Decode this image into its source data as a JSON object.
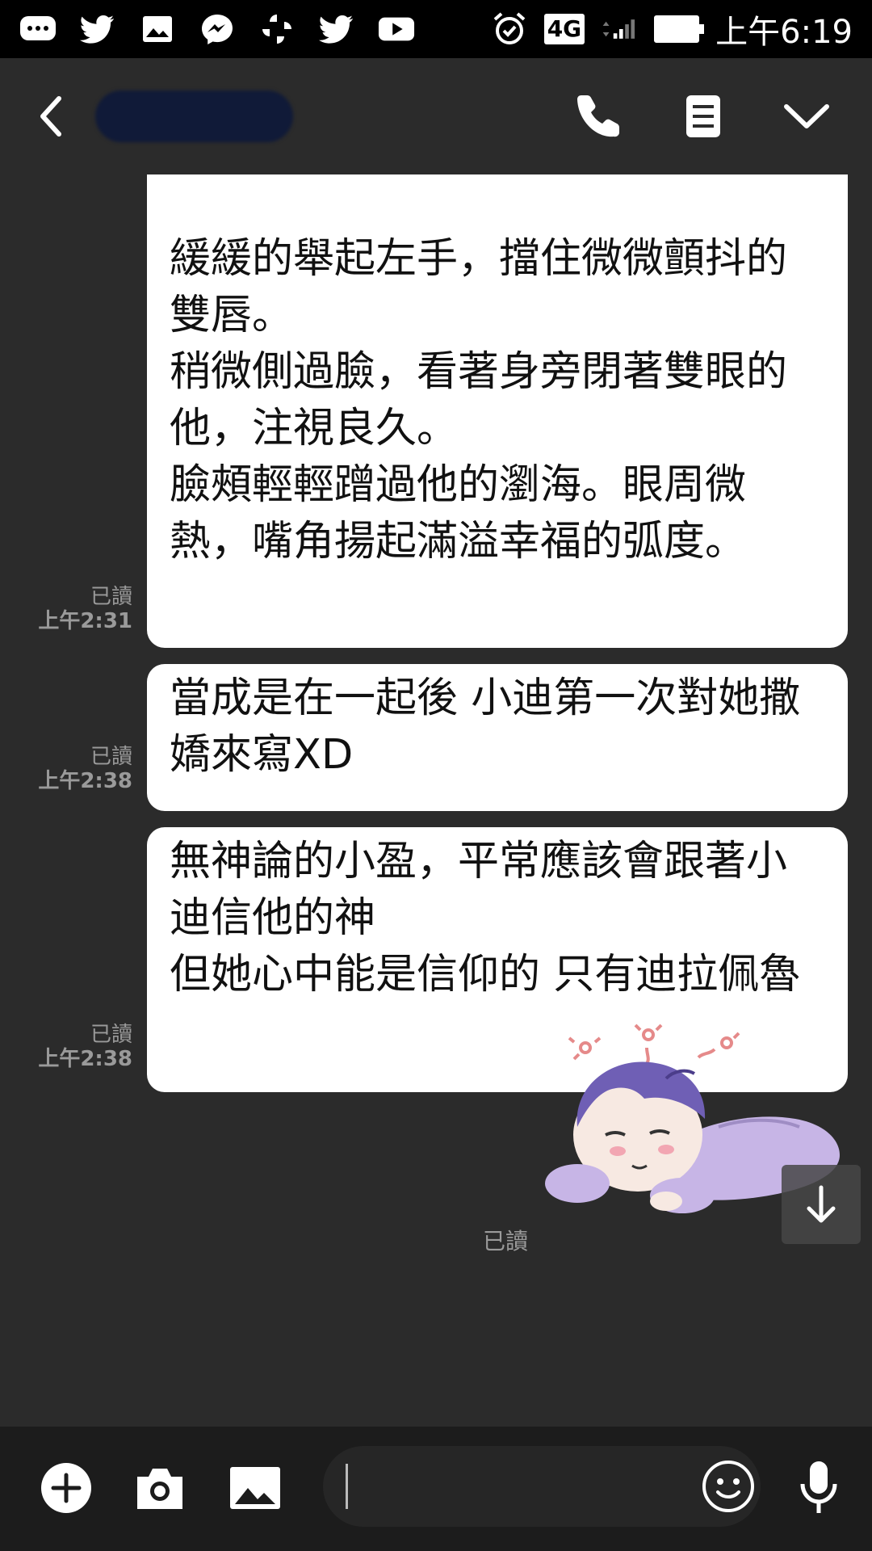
{
  "status_bar": {
    "network": "4G",
    "clock": "上午6:19",
    "icons": [
      "chat-bubble-icon",
      "twitter-icon",
      "gallery-icon",
      "messenger-icon",
      "pinwheel-icon",
      "twitter-icon",
      "youtube-icon",
      "alarm-icon",
      "signal-icon",
      "battery-icon"
    ]
  },
  "header": {
    "contact_name": "",
    "icons": [
      "back-chevron-icon",
      "phone-icon",
      "notes-icon",
      "chevron-down-icon"
    ]
  },
  "messages": [
    {
      "read": "已讀",
      "time": "上午2:31",
      "text": "\n緩緩的舉起左手，擋住微微顫抖的雙唇。\n稍微側過臉，看著身旁閉著雙眼的他，注視良久。\n臉頰輕輕蹭過他的瀏海。眼周微熱，嘴角揚起滿溢幸福的弧度。"
    },
    {
      "read": "已讀",
      "time": "上午2:38",
      "text": "當成是在一起後 小迪第一次對她撒嬌來寫XD"
    },
    {
      "read": "已讀",
      "time": "上午2:38",
      "text": "無神論的小盈，平常應該會跟著小迪信他的神\n但她心中能是信仰的 只有迪拉佩魯"
    }
  ],
  "sticker": {
    "read": "已讀"
  },
  "input_bar": {
    "placeholder": "",
    "icons": [
      "plus-icon",
      "camera-icon",
      "image-icon",
      "emoji-icon",
      "microphone-icon"
    ]
  },
  "colors": {
    "background": "#2b2b2b",
    "bubble": "#ffffff",
    "meta_text": "#9a9a9a",
    "input_bar": "#1c1c1c"
  }
}
